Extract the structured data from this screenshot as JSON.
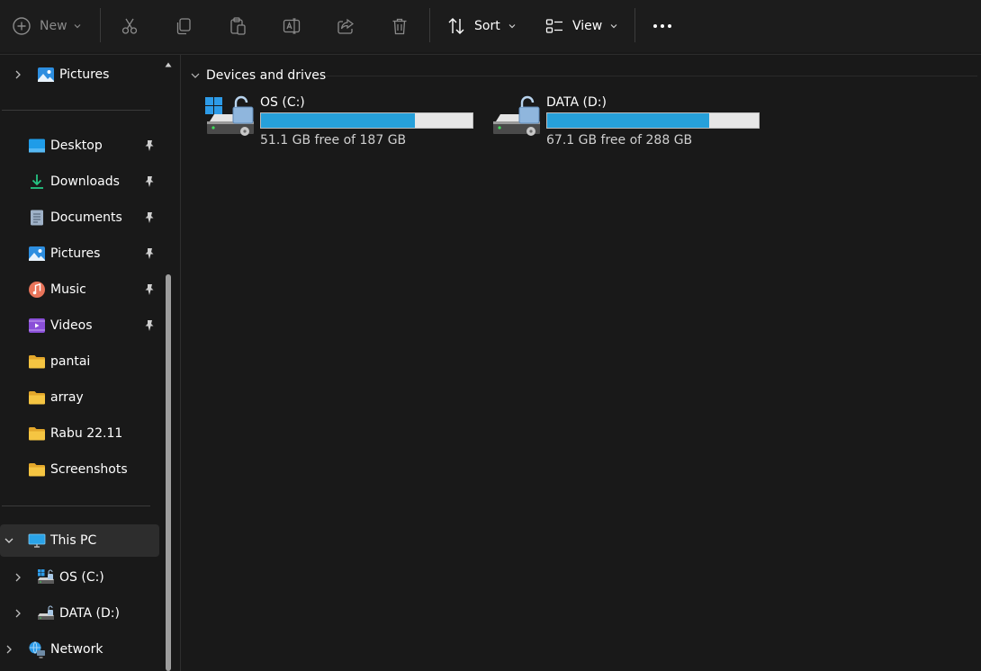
{
  "toolbar": {
    "new_label": "New",
    "sort_label": "Sort",
    "view_label": "View",
    "buttons": [
      "cut-icon",
      "copy-icon",
      "paste-icon",
      "rename-icon",
      "share-icon",
      "delete-icon"
    ]
  },
  "sidebar": {
    "top_item": {
      "label": "Pictures",
      "icon": "pictures-icon"
    },
    "quick_access": [
      {
        "label": "Desktop",
        "icon": "desktop-icon",
        "pinned": true
      },
      {
        "label": "Downloads",
        "icon": "downloads-icon",
        "pinned": true
      },
      {
        "label": "Documents",
        "icon": "documents-icon",
        "pinned": true
      },
      {
        "label": "Pictures",
        "icon": "pictures-icon",
        "pinned": true
      },
      {
        "label": "Music",
        "icon": "music-icon",
        "pinned": true
      },
      {
        "label": "Videos",
        "icon": "videos-icon",
        "pinned": true
      },
      {
        "label": "pantai",
        "icon": "folder-icon",
        "pinned": false
      },
      {
        "label": "array",
        "icon": "folder-icon",
        "pinned": false
      },
      {
        "label": "Rabu 22.11",
        "icon": "folder-icon",
        "pinned": false
      },
      {
        "label": "Screenshots",
        "icon": "folder-icon",
        "pinned": false
      }
    ],
    "this_pc": {
      "label": "This PC",
      "icon": "this-pc-icon",
      "expanded": true
    },
    "drives": [
      {
        "label": "OS (C:)",
        "icon": "drive-icon"
      },
      {
        "label": "DATA (D:)",
        "icon": "drive-icon"
      }
    ],
    "network": {
      "label": "Network",
      "icon": "network-icon"
    }
  },
  "main": {
    "group_label": "Devices and drives",
    "drives": [
      {
        "name": "OS (C:)",
        "free_text": "51.1 GB free of 187 GB",
        "used_fraction": 0.727,
        "system": true
      },
      {
        "name": "DATA (D:)",
        "free_text": "67.1 GB free of 288 GB",
        "used_fraction": 0.767,
        "system": false
      }
    ]
  },
  "colors": {
    "background": "#191919",
    "toolbar": "#1c1c1c",
    "selection": "#2d2d2d",
    "accent_bar": "#26a0da",
    "folder": "#f5c542",
    "text": "#ffffff",
    "disabled_icon": "#8a8a8a"
  }
}
